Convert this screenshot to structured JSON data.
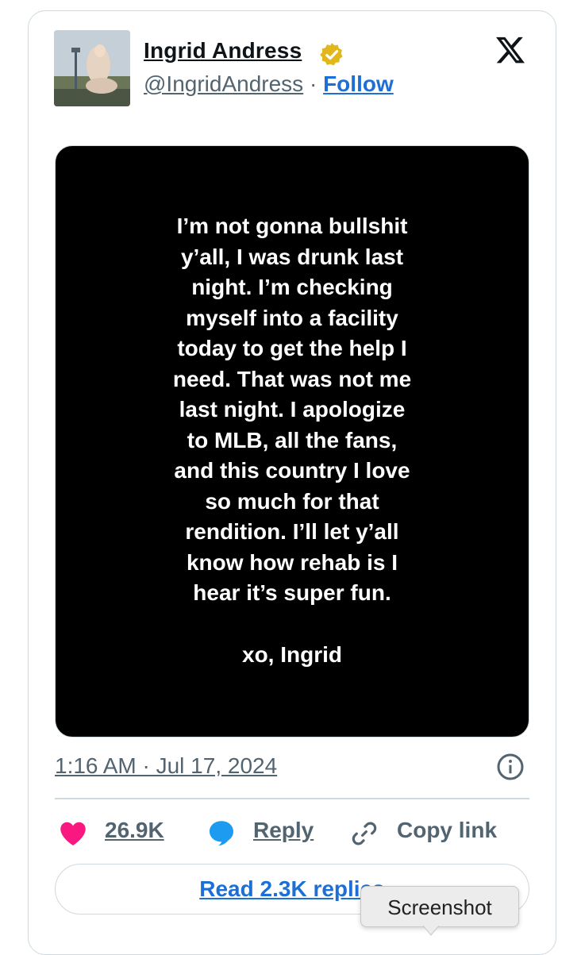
{
  "tweet": {
    "author_name": "Ingrid Andress",
    "handle": "@IngridAndress",
    "separator": " · ",
    "follow_label": "Follow",
    "media_text": "I’m not gonna bullshit\ny’all, I was drunk last\nnight. I’m checking\nmyself into a facility\ntoday to get the help I\nneed. That was not me\nlast night. I apologize\nto MLB, all the fans,\nand this country I love\nso much for that\nrendition. I’ll let y’all\nknow how rehab is I\nhear it’s super fun.",
    "media_signoff": "xo, Ingrid",
    "timestamp": "1:16 AM · Jul 17, 2024"
  },
  "actions": {
    "likes": "26.9K",
    "reply_label": "Reply",
    "copy_link_label": "Copy link"
  },
  "read_replies_label": "Read 2.3K replies",
  "tooltip_text": "Screenshot",
  "icons": {
    "verified": "verified-badge-icon",
    "logo": "x-logo-icon",
    "info": "info-icon",
    "like": "heart-icon",
    "reply": "speech-bubble-icon",
    "copy": "link-icon"
  },
  "colors": {
    "accent": "#1d6fd6",
    "heart": "#f91880",
    "verified": "#e2b719",
    "muted": "#536471"
  }
}
